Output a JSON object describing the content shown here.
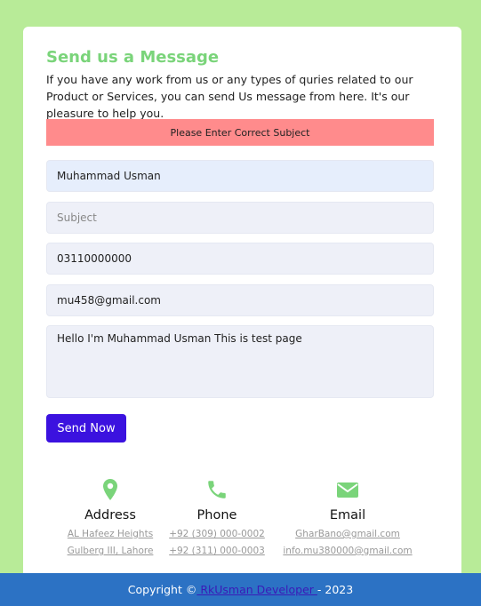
{
  "form": {
    "title": "Send us a Message",
    "intro": "If you have any work from us or any types of quries related to our Product or Services, you can send Us message from here. It's our pleasure to help you.",
    "alert": "Please Enter Correct Subject",
    "name_value": "Muhammad Usman",
    "subject_placeholder": "Subject",
    "phone_value": "03110000000",
    "email_value": "mu458@gmail.com",
    "message_value": "Hello I'm Muhammad Usman This is test page",
    "send_label": "Send Now"
  },
  "contact": {
    "address": {
      "heading": "Address",
      "icon": "map-pin-icon",
      "lines": [
        "AL Hafeez Heights",
        "Gulberg III, Lahore"
      ]
    },
    "phone": {
      "heading": "Phone",
      "icon": "phone-icon",
      "lines": [
        "+92 (309) 000-0002",
        "+92 (311) 000-0003"
      ]
    },
    "email": {
      "heading": "Email",
      "icon": "envelope-icon",
      "lines": [
        "GharBano@gmail.com",
        "info.mu380000@gmail.com"
      ]
    }
  },
  "footer": {
    "prefix": "Copyright ©",
    "link": " RkUsman Developer ",
    "suffix": "- 2023"
  },
  "colors": {
    "page_bg": "#b8eb98",
    "title": "#7ad47a",
    "alert_bg": "#ff8b8c",
    "button_bg": "#3b12df",
    "footer_bg": "#2c72c4",
    "icon": "#7ad47a"
  }
}
